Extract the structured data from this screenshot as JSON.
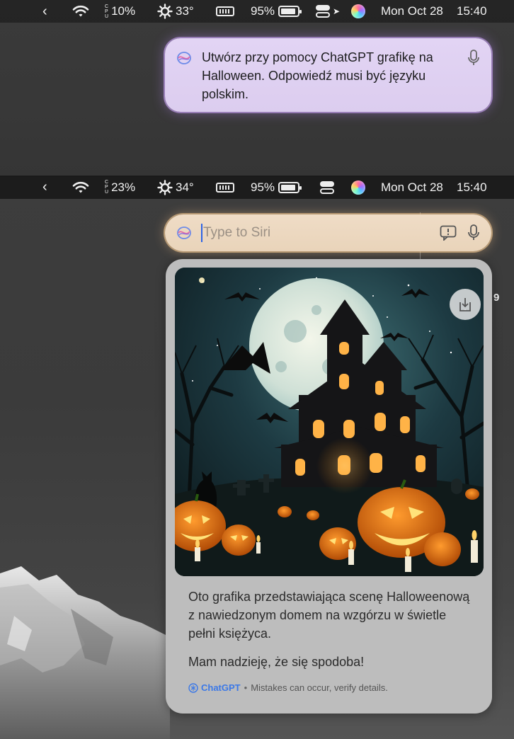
{
  "menubar_top": {
    "chevron": "‹",
    "cpu_label": [
      "C",
      "P",
      "U"
    ],
    "cpu": "10%",
    "temp": "33°",
    "battery": "95%",
    "date": "Mon Oct 28",
    "time": "15:40"
  },
  "menubar_bottom": {
    "chevron": "‹",
    "cpu_label": [
      "C",
      "P",
      "U"
    ],
    "cpu": "23%",
    "temp": "34°",
    "battery": "95%",
    "date": "Mon Oct 28",
    "time": "15:40"
  },
  "prompt": {
    "text": "Utwórz przy pomocy ChatGPT grafikę na Halloween. Odpowiedź musi być języku polskim."
  },
  "siri_input": {
    "placeholder": "Type to Siri"
  },
  "response": {
    "paragraph_1": "Oto grafika przedstawiająca scenę Halloweenową z nawiedzonym domem na wzgórzu w świetle pełni księżyca.",
    "paragraph_2": "Mam nadzieję, że się spodoba!",
    "brand": "ChatGPT",
    "separator": "•",
    "disclaimer": "Mistakes can occur, verify details."
  },
  "side_number": "9",
  "colors": {
    "prompt_bubble": "#dccdef",
    "siri_input": "#e9d4ba",
    "card": "#bdbdbd",
    "accent_blue": "#3b78e7"
  }
}
